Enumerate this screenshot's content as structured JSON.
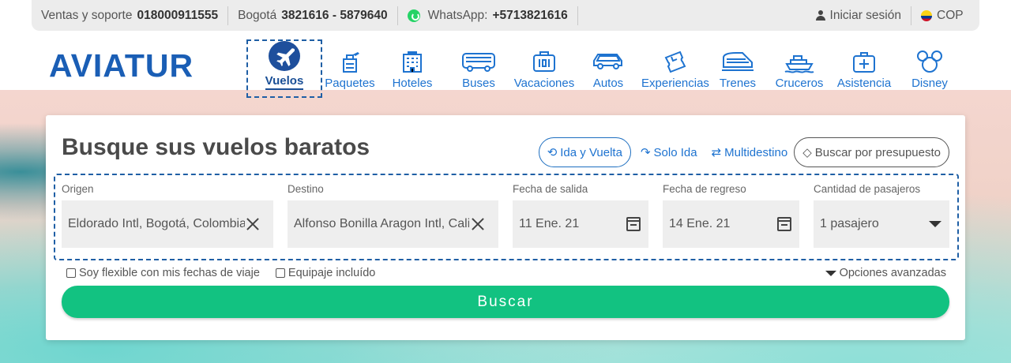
{
  "topbar": {
    "sales_label": "Ventas y soporte",
    "sales_phone": "018000911555",
    "city_label": "Bogotá",
    "city_phones": "3821616 - 5879640",
    "whatsapp_label": "WhatsApp:",
    "whatsapp_phone": "+5713821616",
    "login": "Iniciar sesión",
    "currency": "COP"
  },
  "brand": {
    "logo": "AVIATUR"
  },
  "nav": [
    {
      "label": "Vuelos",
      "icon": "airplane-icon",
      "active": true
    },
    {
      "label": "Paquetes",
      "icon": "package-icon"
    },
    {
      "label": "Hoteles",
      "icon": "hotel-icon"
    },
    {
      "label": "Buses",
      "icon": "bus-icon"
    },
    {
      "label": "Vacaciones",
      "icon": "suitcase-icon"
    },
    {
      "label": "Autos",
      "icon": "car-icon"
    },
    {
      "label": "Experiencias",
      "icon": "tickets-icon"
    },
    {
      "label": "Trenes",
      "icon": "train-icon"
    },
    {
      "label": "Cruceros",
      "icon": "ship-icon"
    },
    {
      "label": "Asistencia",
      "icon": "first-aid-icon"
    },
    {
      "label": "Disney",
      "icon": "mickey-icon"
    }
  ],
  "search": {
    "title": "Busque sus vuelos baratos",
    "trip_types": {
      "round_trip": "Ida y Vuelta",
      "one_way": "Solo Ida",
      "multi": "Multidestino",
      "budget": "Buscar por presupuesto"
    },
    "origin": {
      "label": "Origen",
      "value": "Eldorado Intl, Bogotá, Colombia"
    },
    "destination": {
      "label": "Destino",
      "value": "Alfonso Bonilla Aragon Intl, Cali, Colombia"
    },
    "departure": {
      "label": "Fecha de salida",
      "value": "11 Ene. 21"
    },
    "return": {
      "label": "Fecha de regreso",
      "value": "14 Ene. 21"
    },
    "passengers": {
      "label": "Cantidad de pasajeros",
      "value": "1 pasajero"
    },
    "flexible": "Soy flexible con mis fechas de viaje",
    "baggage": "Equipaje incluído",
    "advanced": "Opciones avanzadas",
    "submit": "Buscar"
  },
  "colors": {
    "brand_blue": "#1a5eb5",
    "action_green": "#12c281"
  }
}
